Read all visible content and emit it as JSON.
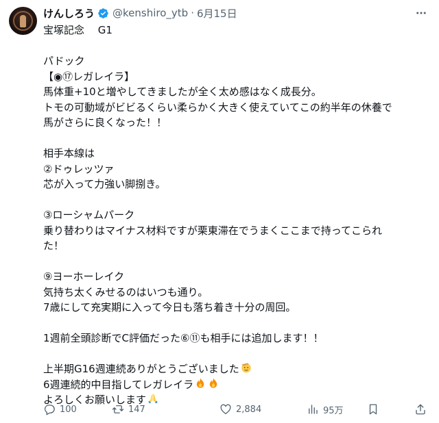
{
  "tweet": {
    "author_name": "けんしろう",
    "handle": "@kenshiro_ytb",
    "separator": "·",
    "date": "6月15日",
    "lines": [
      "宝塚記念　 G1",
      "",
      "パドック",
      "【◉⑰レガレイラ】",
      "馬体重+10と増やしてきましたが全く太め感はなく成長分。",
      "トモの可動域がビビるくらい柔らかく大きく使えていてこの約半年の休養で",
      "馬がさらに良くなった！！",
      "",
      "相手本線は",
      "②ドゥレッツァ",
      "芯が入って力強い脚捌き。",
      "",
      "③ローシャムパーク",
      "乗り替わりはマイナス材料ですが栗東滞在でうまくここまで持ってこられ",
      "た！",
      "",
      "⑨ヨーホーレイク",
      "気持ち太くみせるのはいつも通り。",
      "7歳にして充実期に入って今日も落ち着き十分の周回。",
      "",
      "1週前全頭診断でC評価だった⑥⑪も相手には追加します！！",
      "",
      "上半期G16週連続ありがとうございました",
      "6週連続的中目指してレガレイラ",
      "よろしくお願いします"
    ],
    "emoji": {
      "line22": "saluting-face-emoji",
      "line23": "fire-emoji fire-emoji",
      "line24": "folded-hands-emoji"
    }
  },
  "actions": {
    "replies": "100",
    "retweets": "147",
    "likes": "2,884",
    "views": "95万"
  },
  "colors": {
    "text": "#0f1419",
    "secondary": "#536471",
    "verified": "#1d9bf0"
  }
}
